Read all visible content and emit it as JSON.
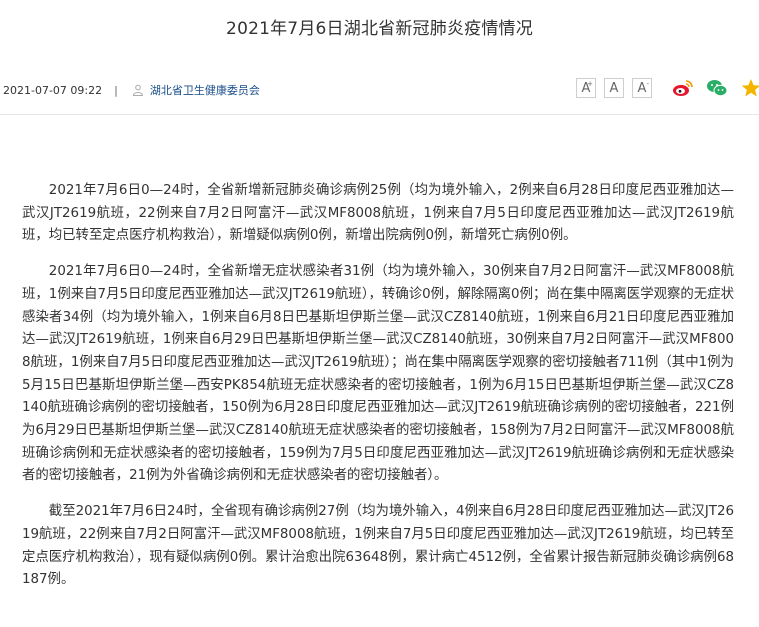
{
  "article": {
    "title": "2021年7月6日湖北省新冠肺炎疫情情况",
    "date": "2021-07-07 09:22",
    "separator": "|",
    "source": "湖北省卫生健康委员会"
  },
  "font_controls": {
    "increase_label": "A",
    "increase_sup": "+",
    "default_label": "A",
    "decrease_label": "A",
    "decrease_sup": "-"
  },
  "share_icons": [
    "weibo-icon",
    "wechat-icon",
    "favorite-star-icon"
  ],
  "colors": {
    "text": "#333333",
    "source_link": "#1a4f8a",
    "weibo": "#e6162d",
    "wechat": "#2aae67",
    "star": "#f5b400"
  },
  "paragraphs": [
    "2021年7月6日0—24时，全省新增新冠肺炎确诊病例25例（均为境外输入，2例来自6月28日印度尼西亚雅加达—武汉JT2619航班，22例来自7月2日阿富汗—武汉MF8008航班，1例来自7月5日印度尼西亚雅加达—武汉JT2619航班，均已转至定点医疗机构救治），新增疑似病例0例，新增出院病例0例，新增死亡病例0例。",
    "2021年7月6日0—24时，全省新增无症状感染者31例（均为境外输入，30例来自7月2日阿富汗—武汉MF8008航班，1例来自7月5日印度尼西亚雅加达—武汉JT2619航班），转确诊0例，解除隔离0例；尚在集中隔离医学观察的无症状感染者34例（均为境外输入，1例来自6月8日巴基斯坦伊斯兰堡—武汉CZ8140航班，1例来自6月21日印度尼西亚雅加达—武汉JT2619航班，1例来自6月29日巴基斯坦伊斯兰堡—武汉CZ8140航班，30例来自7月2日阿富汗—武汉MF8008航班，1例来自7月5日印度尼西亚雅加达—武汉JT2619航班）；尚在集中隔离医学观察的密切接触者711例（其中1例为5月15日巴基斯坦伊斯兰堡—西安PK854航班无症状感染者的密切接触者，1例为6月15日巴基斯坦伊斯兰堡—武汉CZ8140航班确诊病例的密切接触者，150例为6月28日印度尼西亚雅加达—武汉JT2619航班确诊病例的密切接触者，221例为6月29日巴基斯坦伊斯兰堡—武汉CZ8140航班无症状感染者的密切接触者，158例为7月2日阿富汗—武汉MF8008航班确诊病例和无症状感染者的密切接触者，159例为7月5日印度尼西亚雅加达—武汉JT2619航班确诊病例和无症状感染者的密切接触者，21例为外省确诊病例和无症状感染者的密切接触者）。",
    "截至2021年7月6日24时，全省现有确诊病例27例（均为境外输入，4例来自6月28日印度尼西亚雅加达—武汉JT2619航班，22例来自7月2日阿富汗—武汉MF8008航班，1例来自7月5日印度尼西亚雅加达—武汉JT2619航班，均已转至定点医疗机构救治），现有疑似病例0例。累计治愈出院63648例，累计病亡4512例，全省累计报告新冠肺炎确诊病例68187例。"
  ]
}
